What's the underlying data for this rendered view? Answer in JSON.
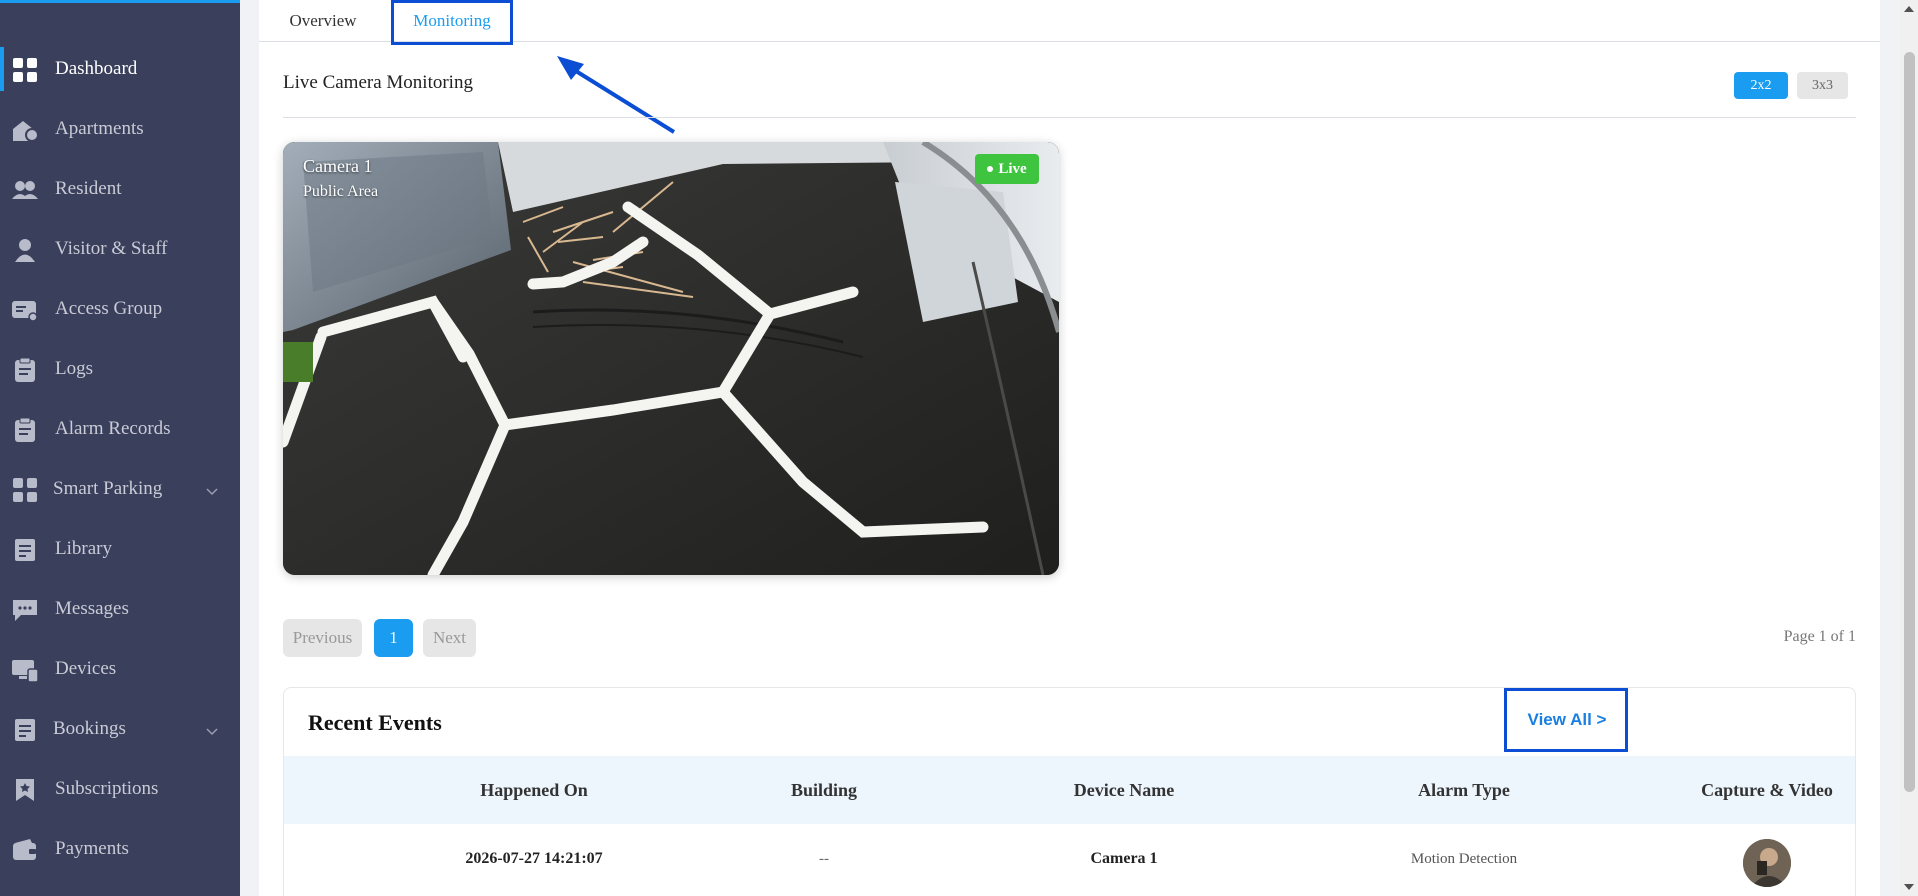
{
  "sidebar": {
    "items": [
      {
        "label": "Dashboard",
        "icon": "dashboard-icon"
      },
      {
        "label": "Apartments",
        "icon": "apartment-icon"
      },
      {
        "label": "Resident",
        "icon": "resident-icon"
      },
      {
        "label": "Visitor & Staff",
        "icon": "visitor-icon"
      },
      {
        "label": "Access Group",
        "icon": "access-group-icon"
      },
      {
        "label": "Logs",
        "icon": "logs-icon"
      },
      {
        "label": "Alarm Records",
        "icon": "alarm-records-icon"
      },
      {
        "label": "Smart Parking",
        "icon": "smart-parking-icon"
      },
      {
        "label": "Library",
        "icon": "library-icon"
      },
      {
        "label": "Messages",
        "icon": "messages-icon"
      },
      {
        "label": "Devices",
        "icon": "devices-icon"
      },
      {
        "label": "Bookings",
        "icon": "bookings-icon"
      },
      {
        "label": "Subscriptions",
        "icon": "subscriptions-icon"
      },
      {
        "label": "Payments",
        "icon": "payments-icon"
      }
    ],
    "active": "Dashboard"
  },
  "tabs": {
    "overview": "Overview",
    "monitoring": "Monitoring",
    "active": "Monitoring"
  },
  "monitoring": {
    "title": "Live Camera Monitoring",
    "grid_2x2": "2x2",
    "grid_3x3": "3x3",
    "camera": {
      "name": "Camera 1",
      "area": "Public Area",
      "status": "Live"
    },
    "pagination": {
      "previous": "Previous",
      "page": "1",
      "next": "Next",
      "info": "Page 1 of 1"
    }
  },
  "events": {
    "title": "Recent Events",
    "view_all": "View All >",
    "columns": [
      "Happened On",
      "Building",
      "Device Name",
      "Alarm Type",
      "Capture & Video"
    ],
    "rows": [
      {
        "happened_on": "2026-07-27 14:21:07",
        "building": "--",
        "device_name": "Camera 1",
        "alarm_type": "Motion Detection"
      }
    ]
  },
  "colors": {
    "sidebar_bg": "#3a3f5c",
    "accent": "#1a9cf0",
    "live_green": "#3ec43e",
    "annotation_blue": "#0b4ed4"
  }
}
